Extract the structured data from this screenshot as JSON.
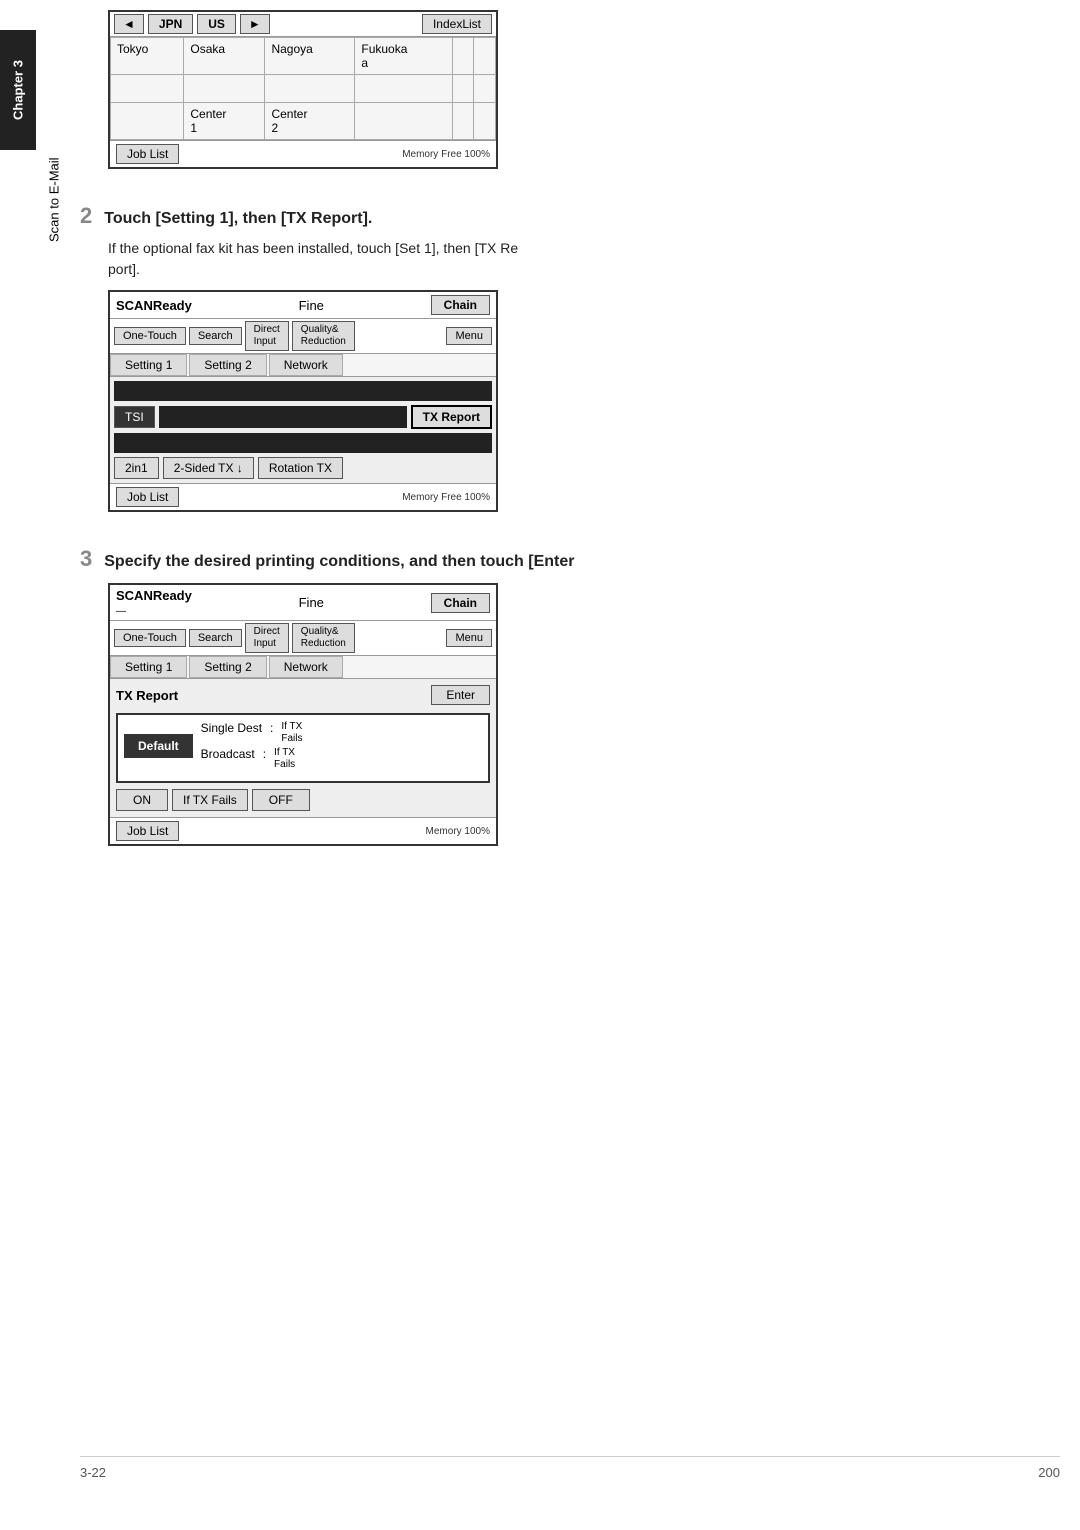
{
  "chapter": {
    "label": "Chapter 3"
  },
  "sidebar": {
    "label": "Scan to E-Mail"
  },
  "screen0": {
    "nav_prev": "◄",
    "nav_jpn": "JPN",
    "nav_us": "US",
    "nav_next": "►",
    "nav_index": "IndexList",
    "grid": [
      [
        "Tokyo",
        "Osaka",
        "Nagoya",
        "Fukuoka",
        "",
        ""
      ],
      [
        "",
        "",
        "",
        "",
        "",
        ""
      ],
      [
        "",
        "Center 1",
        "Center 2",
        "",
        "",
        ""
      ],
      [
        "",
        "",
        "",
        "",
        "",
        ""
      ]
    ],
    "job_list": "Job List",
    "memory": "Memory Free 100%"
  },
  "step2": {
    "number": "2",
    "text": "Touch [Setting 1], then [TX Report].",
    "sub": "If the optional fax kit has been installed, touch [Set 1], then [TX Report].",
    "sub2": "port]."
  },
  "screen1": {
    "status": "SCANReady",
    "mode": "Fine",
    "chain": "Chain",
    "one_touch": "One-Touch",
    "search": "Search",
    "direct_input": "Direct Input",
    "quality": "Quality& Reduction",
    "menu": "Menu",
    "setting1": "Setting 1",
    "setting2": "Setting 2",
    "network": "Network",
    "tsi": "TSI",
    "tx_report": "TX Report",
    "btn_2in1": "2in1",
    "btn_2sided": "2-Sided TX ↓",
    "btn_rotation": "Rotation TX",
    "job_list": "Job List",
    "memory": "Memory Free 100%"
  },
  "step3": {
    "number": "3",
    "text": "Specify the desired printing conditions, and then touch [Enter"
  },
  "screen2": {
    "status": "SCANReady",
    "indicator": "—",
    "mode": "Fine",
    "chain": "Chain",
    "one_touch": "One-Touch",
    "search": "Search",
    "direct_input": "Direct Input",
    "quality": "Quality& Reduction",
    "menu": "Menu",
    "setting1": "Setting 1",
    "setting2": "Setting 2",
    "network": "Network",
    "tx_report_title": "TX Report",
    "enter": "Enter",
    "default": "Default",
    "single_dest": "Single Dest",
    "broadcast": "Broadcast",
    "colon": ":",
    "if_tx_fails1": "If TX Fails",
    "if_tx_fails2": "If TX Fails",
    "on": "ON",
    "if_tx_fails_mid": "If TX Fails",
    "off": "OFF",
    "job_list": "Job List",
    "memory": "Memory 100%"
  },
  "footer": {
    "page_num": "3-22",
    "page_right": "200"
  }
}
